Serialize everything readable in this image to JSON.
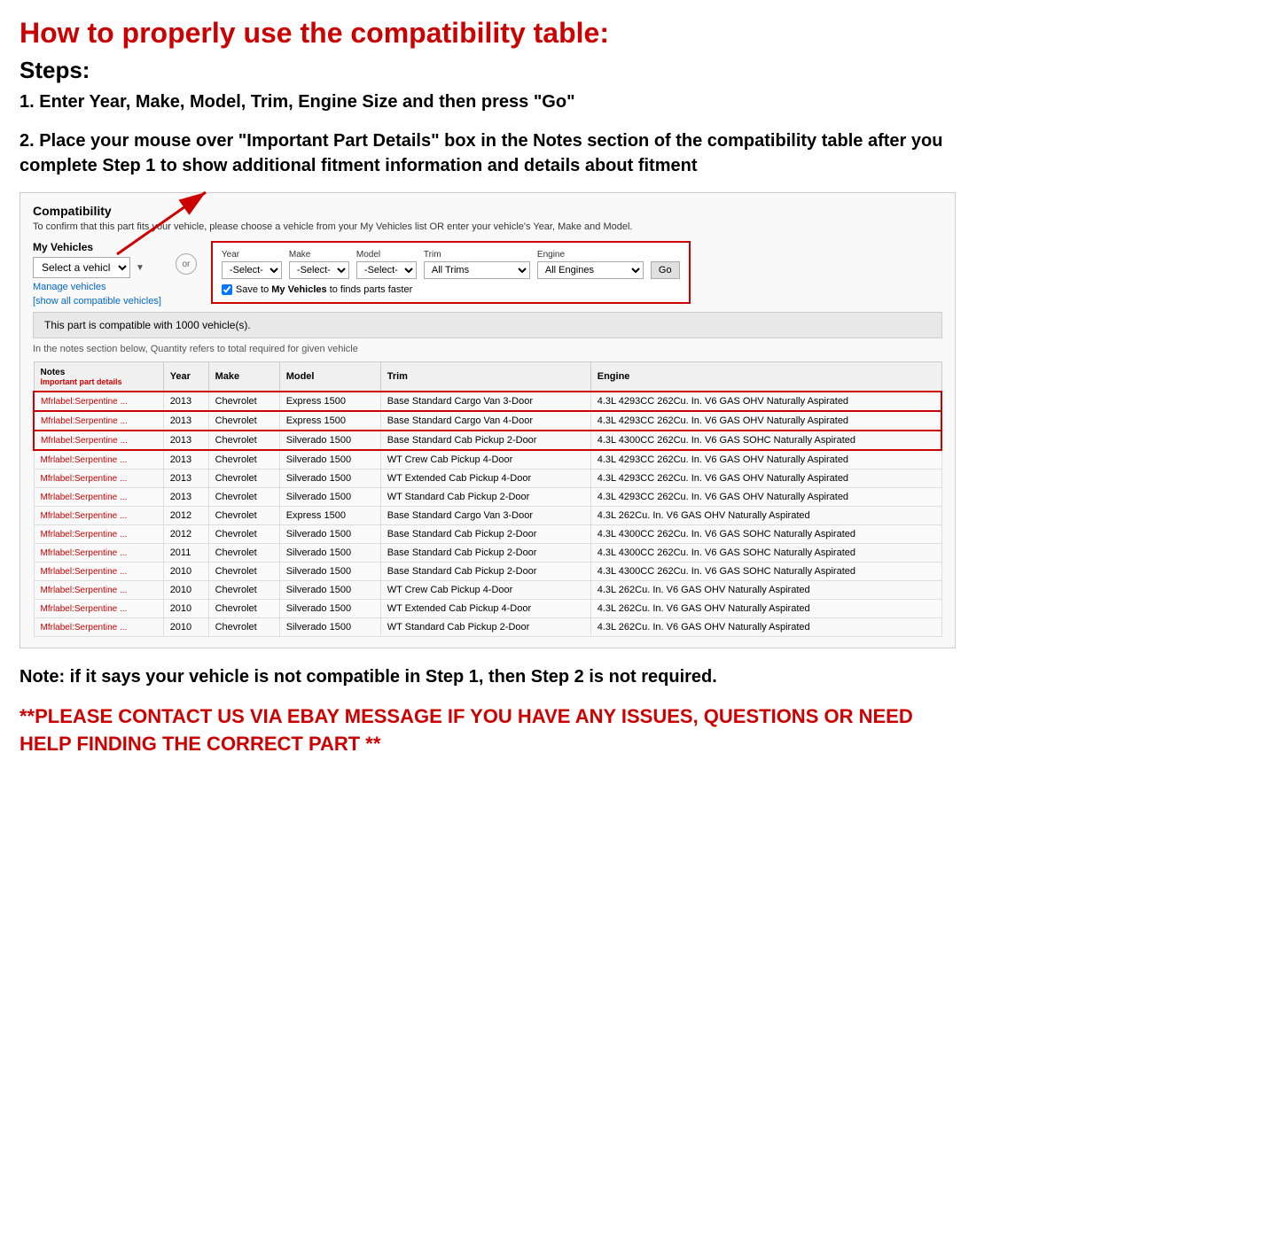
{
  "page": {
    "main_title": "How to properly use the compatibility table:",
    "steps_title": "Steps:",
    "step1": "1. Enter Year, Make, Model, Trim, Engine Size and then press \"Go\"",
    "step2": "2. Place your mouse over \"Important Part Details\" box in the Notes section of the compatibility table after you complete Step 1 to show additional fitment information and details about fitment",
    "note": "Note: if it says your vehicle is not compatible in Step 1, then Step 2 is not required.",
    "contact": "**PLEASE CONTACT US VIA EBAY MESSAGE IF YOU HAVE ANY ISSUES, QUESTIONS OR NEED HELP FINDING THE CORRECT PART **"
  },
  "compatibility_box": {
    "title": "Compatibility",
    "subtitle": "To confirm that this part fits your vehicle, please choose a vehicle from your My Vehicles list OR enter your vehicle's Year, Make and Model.",
    "my_vehicles_label": "My Vehicles",
    "select_vehicle_placeholder": "Select a vehicle",
    "manage_vehicles": "Manage vehicles",
    "show_all": "[show all compatible vehicles]",
    "or_label": "or",
    "year_label": "Year",
    "year_value": "-Select-",
    "make_label": "Make",
    "make_value": "-Select-",
    "model_label": "Model",
    "model_value": "-Select-",
    "trim_label": "Trim",
    "trim_value": "All Trims",
    "engine_label": "Engine",
    "engine_value": "All Engines",
    "go_button": "Go",
    "save_text": "Save to ",
    "save_bold": "My Vehicles",
    "save_rest": " to finds parts faster",
    "compat_count": "This part is compatible with 1000 vehicle(s).",
    "quantity_note": "In the notes section below, Quantity refers to total required for given vehicle"
  },
  "table": {
    "headers": [
      "Notes",
      "Year",
      "Make",
      "Model",
      "Trim",
      "Engine"
    ],
    "notes_subheader": "Important part details",
    "rows": [
      {
        "notes": "Mfrlabel:Serpentine ...",
        "year": "2013",
        "make": "Chevrolet",
        "model": "Express 1500",
        "trim": "Base Standard Cargo Van 3-Door",
        "engine": "4.3L 4293CC 262Cu. In. V6 GAS OHV Naturally Aspirated",
        "highlight": true
      },
      {
        "notes": "Mfrlabel:Serpentine ...",
        "year": "2013",
        "make": "Chevrolet",
        "model": "Express 1500",
        "trim": "Base Standard Cargo Van 4-Door",
        "engine": "4.3L 4293CC 262Cu. In. V6 GAS OHV Naturally Aspirated",
        "highlight": true
      },
      {
        "notes": "Mfrlabel:Serpentine ...",
        "year": "2013",
        "make": "Chevrolet",
        "model": "Silverado 1500",
        "trim": "Base Standard Cab Pickup 2-Door",
        "engine": "4.3L 4300CC 262Cu. In. V6 GAS SOHC Naturally Aspirated",
        "highlight": true
      },
      {
        "notes": "Mfrlabel:Serpentine ...",
        "year": "2013",
        "make": "Chevrolet",
        "model": "Silverado 1500",
        "trim": "WT Crew Cab Pickup 4-Door",
        "engine": "4.3L 4293CC 262Cu. In. V6 GAS OHV Naturally Aspirated",
        "highlight": false
      },
      {
        "notes": "Mfrlabel:Serpentine ...",
        "year": "2013",
        "make": "Chevrolet",
        "model": "Silverado 1500",
        "trim": "WT Extended Cab Pickup 4-Door",
        "engine": "4.3L 4293CC 262Cu. In. V6 GAS OHV Naturally Aspirated",
        "highlight": false
      },
      {
        "notes": "Mfrlabel:Serpentine ...",
        "year": "2013",
        "make": "Chevrolet",
        "model": "Silverado 1500",
        "trim": "WT Standard Cab Pickup 2-Door",
        "engine": "4.3L 4293CC 262Cu. In. V6 GAS OHV Naturally Aspirated",
        "highlight": false
      },
      {
        "notes": "Mfrlabel:Serpentine ...",
        "year": "2012",
        "make": "Chevrolet",
        "model": "Express 1500",
        "trim": "Base Standard Cargo Van 3-Door",
        "engine": "4.3L 262Cu. In. V6 GAS OHV Naturally Aspirated",
        "highlight": false
      },
      {
        "notes": "Mfrlabel:Serpentine ...",
        "year": "2012",
        "make": "Chevrolet",
        "model": "Silverado 1500",
        "trim": "Base Standard Cab Pickup 2-Door",
        "engine": "4.3L 4300CC 262Cu. In. V6 GAS SOHC Naturally Aspirated",
        "highlight": false
      },
      {
        "notes": "Mfrlabel:Serpentine ...",
        "year": "2011",
        "make": "Chevrolet",
        "model": "Silverado 1500",
        "trim": "Base Standard Cab Pickup 2-Door",
        "engine": "4.3L 4300CC 262Cu. In. V6 GAS SOHC Naturally Aspirated",
        "highlight": false
      },
      {
        "notes": "Mfrlabel:Serpentine ...",
        "year": "2010",
        "make": "Chevrolet",
        "model": "Silverado 1500",
        "trim": "Base Standard Cab Pickup 2-Door",
        "engine": "4.3L 4300CC 262Cu. In. V6 GAS SOHC Naturally Aspirated",
        "highlight": false
      },
      {
        "notes": "Mfrlabel:Serpentine ...",
        "year": "2010",
        "make": "Chevrolet",
        "model": "Silverado 1500",
        "trim": "WT Crew Cab Pickup 4-Door",
        "engine": "4.3L 262Cu. In. V6 GAS OHV Naturally Aspirated",
        "highlight": false
      },
      {
        "notes": "Mfrlabel:Serpentine ...",
        "year": "2010",
        "make": "Chevrolet",
        "model": "Silverado 1500",
        "trim": "WT Extended Cab Pickup 4-Door",
        "engine": "4.3L 262Cu. In. V6 GAS OHV Naturally Aspirated",
        "highlight": false
      },
      {
        "notes": "Mfrlabel:Serpentine ...",
        "year": "2010",
        "make": "Chevrolet",
        "model": "Silverado 1500",
        "trim": "WT Standard Cab Pickup 2-Door",
        "engine": "4.3L 262Cu. In. V6 GAS OHV Naturally Aspirated",
        "highlight": false
      }
    ]
  }
}
